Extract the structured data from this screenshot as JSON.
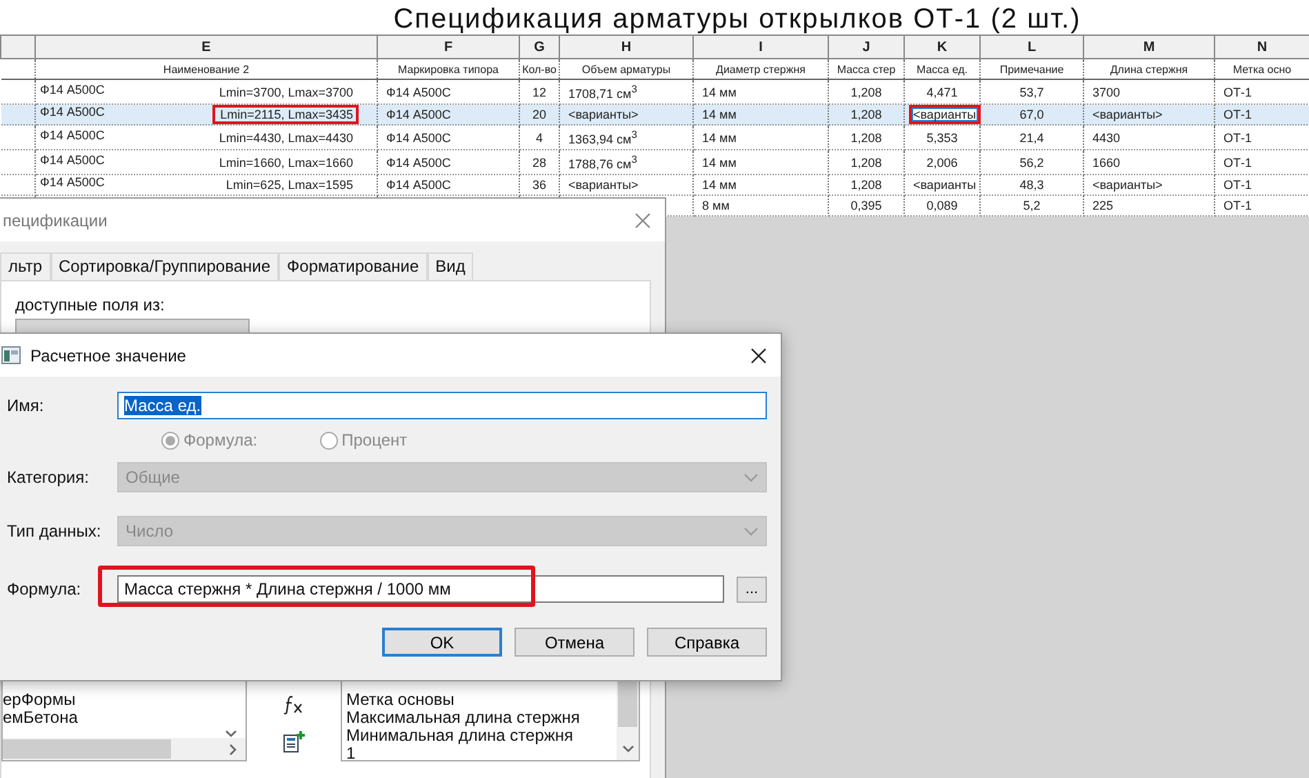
{
  "sheet": {
    "title": "Спецификация арматуры открылков ОТ-1 (2 шт.)",
    "columns": [
      {
        "letter": "E",
        "heading": "Наименование 2"
      },
      {
        "letter": "F",
        "heading": "Маркировка типора"
      },
      {
        "letter": "G",
        "heading": "Кол-во"
      },
      {
        "letter": "H",
        "heading": "Объем арматуры"
      },
      {
        "letter": "I",
        "heading": "Диаметр стержня"
      },
      {
        "letter": "J",
        "heading": "Масса стер"
      },
      {
        "letter": "K",
        "heading": "Масса ед."
      },
      {
        "letter": "L",
        "heading": "Примечание"
      },
      {
        "letter": "M",
        "heading": "Длина стержня"
      },
      {
        "letter": "N",
        "heading": "Метка осно"
      }
    ],
    "rows": [
      {
        "selected": false,
        "name": "Ф14 А500С",
        "range": "Lmin=3700,  Lmax=3700",
        "range_marked": false,
        "cells": {
          "F": "Ф14 А500С",
          "G": "12",
          "H": "1708,71 см$^{3}$",
          "I": "14 мм",
          "J": "1,208",
          "K": "4,471",
          "L": "53,7",
          "M": "3700",
          "N": "ОТ-1"
        }
      },
      {
        "selected": true,
        "name": "Ф14 А500С",
        "range": "Lmin=2115,  Lmax=3435",
        "range_marked": true,
        "cells": {
          "F": "Ф14 А500С",
          "G": "20",
          "H": "<варианты>",
          "I": "14 мм",
          "J": "1,208",
          "K": {
            "text": "<варианты",
            "active": true,
            "marked": true
          },
          "L": "67,0",
          "M": "<варианты>",
          "N": "ОТ-1"
        }
      },
      {
        "selected": false,
        "name": "Ф14 А500С",
        "range": "Lmin=4430,  Lmax=4430",
        "range_marked": false,
        "cells": {
          "F": "Ф14 А500С",
          "G": "4",
          "H": "1363,94 см$^{3}$",
          "I": "14 мм",
          "J": "1,208",
          "K": "5,353",
          "L": "21,4",
          "M": "4430",
          "N": "ОТ-1"
        }
      },
      {
        "selected": false,
        "name": "Ф14 А500С",
        "range": "Lmin=1660,  Lmax=1660",
        "range_marked": false,
        "cells": {
          "F": "Ф14 А500С",
          "G": "28",
          "H": "1788,76 см$^{3}$",
          "I": "14 мм",
          "J": "1,208",
          "K": "2,006",
          "L": "56,2",
          "M": "1660",
          "N": "ОТ-1"
        }
      },
      {
        "selected": false,
        "name": "Ф14 А500С",
        "range": "Lmin=625,  Lmax=1595",
        "range_marked": false,
        "cells": {
          "F": "Ф14 А500С",
          "G": "36",
          "H": "<варианты>",
          "I": "14 мм",
          "J": "1,208",
          "K": "<варианты",
          "L": "48,3",
          "M": "<варианты>",
          "N": "ОТ-1"
        }
      },
      {
        "selected": false,
        "cells": {
          "I": "8 мм",
          "J": "0,395",
          "K": "0,089",
          "L": "5,2",
          "M": "225",
          "N": "ОТ-1"
        }
      }
    ]
  },
  "properties_dialog": {
    "title": "пецификации",
    "tabs": [
      {
        "label": "льтр",
        "selected": false
      },
      {
        "label": "Сортировка/Группирование",
        "selected": false
      },
      {
        "label": "Форматирование",
        "selected": false
      },
      {
        "label": "Вид",
        "selected": false
      }
    ],
    "source_label": "доступные поля из:",
    "available_fields": [
      "ерФормы",
      "емБетона"
    ],
    "scheduled_fields": [
      "Метка основы",
      "Максимальная длина стержня",
      "Минимальная длина стержня",
      "1"
    ]
  },
  "calculated_value_dialog": {
    "title": "Расчетное значение",
    "name": {
      "label": "Имя:",
      "value": "Масса ед.",
      "text_selected": true
    },
    "options": [
      {
        "label": "Формула:",
        "selected": true
      },
      {
        "label": "Процент",
        "selected": false
      }
    ],
    "category": {
      "label": "Категория:",
      "value": "Общие",
      "disabled": true
    },
    "data_type": {
      "label": "Тип данных:",
      "value": "Число",
      "disabled": true
    },
    "formula": {
      "label": "Формула:",
      "value": "Масса стержня * Длина стержня / 1000 мм",
      "marked": true,
      "browse": "..."
    },
    "buttons": [
      {
        "label": "OK",
        "default": true
      },
      {
        "label": "Отмена",
        "default": false
      },
      {
        "label": "Справка",
        "default": false
      }
    ]
  }
}
